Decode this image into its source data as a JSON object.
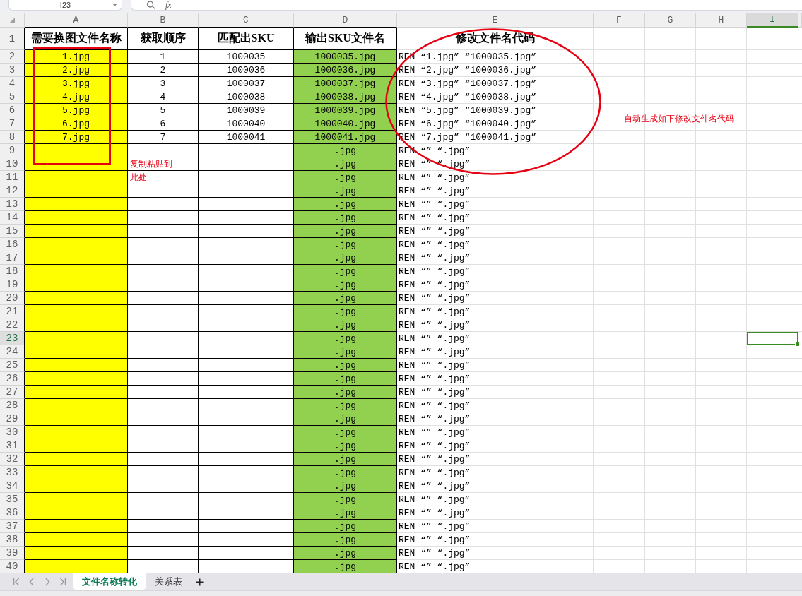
{
  "name_box": {
    "value": "I23"
  },
  "formula_bar": {
    "function_label": "fx"
  },
  "columns": [
    {
      "label": "A",
      "selected": false
    },
    {
      "label": "B",
      "selected": false
    },
    {
      "label": "C",
      "selected": false
    },
    {
      "label": "D",
      "selected": false
    },
    {
      "label": "E",
      "selected": false
    },
    {
      "label": "F",
      "selected": false
    },
    {
      "label": "G",
      "selected": false
    },
    {
      "label": "H",
      "selected": false
    },
    {
      "label": "I",
      "selected": true
    }
  ],
  "rows": [
    {
      "label": "1",
      "selected": false,
      "kind": "header",
      "a": "需要换图文件名称",
      "b": "获取顺序",
      "c": "匹配出SKU",
      "d": "输出SKU文件名",
      "e": "修改文件名代码"
    },
    {
      "label": "2",
      "selected": false,
      "kind": "data",
      "a": "1.jpg",
      "b": "1",
      "c": "1000035",
      "d": "1000035.jpg",
      "e": "REN “1.jpg” “1000035.jpg”"
    },
    {
      "label": "3",
      "selected": false,
      "kind": "data",
      "a": "2.jpg",
      "b": "2",
      "c": "1000036",
      "d": "1000036.jpg",
      "e": "REN “2.jpg” “1000036.jpg”"
    },
    {
      "label": "4",
      "selected": false,
      "kind": "data",
      "a": "3.jpg",
      "b": "3",
      "c": "1000037",
      "d": "1000037.jpg",
      "e": "REN “3.jpg” “1000037.jpg”"
    },
    {
      "label": "5",
      "selected": false,
      "kind": "data",
      "a": "4.jpg",
      "b": "4",
      "c": "1000038",
      "d": "1000038.jpg",
      "e": "REN “4.jpg” “1000038.jpg”"
    },
    {
      "label": "6",
      "selected": false,
      "kind": "data",
      "a": "5.jpg",
      "b": "5",
      "c": "1000039",
      "d": "1000039.jpg",
      "e": "REN “5.jpg” “1000039.jpg”"
    },
    {
      "label": "7",
      "selected": false,
      "kind": "data",
      "a": "6.jpg",
      "b": "6",
      "c": "1000040",
      "d": "1000040.jpg",
      "e": "REN “6.jpg” “1000040.jpg”"
    },
    {
      "label": "8",
      "selected": false,
      "kind": "data",
      "a": "7.jpg",
      "b": "7",
      "c": "1000041",
      "d": "1000041.jpg",
      "e": "REN “7.jpg” “1000041.jpg”"
    },
    {
      "label": "9",
      "selected": false,
      "kind": "data",
      "d": ".jpg",
      "e": "REN “” “.jpg”"
    },
    {
      "label": "10",
      "selected": false,
      "kind": "data",
      "d": ".jpg",
      "e": "REN “” “.jpg”"
    },
    {
      "label": "11",
      "selected": false,
      "kind": "data",
      "d": ".jpg",
      "e": "REN “” “.jpg”"
    },
    {
      "label": "12",
      "selected": false,
      "kind": "data",
      "d": ".jpg",
      "e": "REN “” “.jpg”"
    },
    {
      "label": "13",
      "selected": false,
      "kind": "data",
      "d": ".jpg",
      "e": "REN “” “.jpg”"
    },
    {
      "label": "14",
      "selected": false,
      "kind": "data",
      "d": ".jpg",
      "e": "REN “” “.jpg”"
    },
    {
      "label": "15",
      "selected": false,
      "kind": "data",
      "d": ".jpg",
      "e": "REN “” “.jpg”"
    },
    {
      "label": "16",
      "selected": false,
      "kind": "data",
      "d": ".jpg",
      "e": "REN “” “.jpg”"
    },
    {
      "label": "17",
      "selected": false,
      "kind": "data",
      "d": ".jpg",
      "e": "REN “” “.jpg”"
    },
    {
      "label": "18",
      "selected": false,
      "kind": "data",
      "d": ".jpg",
      "e": "REN “” “.jpg”"
    },
    {
      "label": "19",
      "selected": false,
      "kind": "data",
      "d": ".jpg",
      "e": "REN “” “.jpg”"
    },
    {
      "label": "20",
      "selected": false,
      "kind": "data",
      "d": ".jpg",
      "e": "REN “” “.jpg”"
    },
    {
      "label": "21",
      "selected": false,
      "kind": "data",
      "d": ".jpg",
      "e": "REN “” “.jpg”"
    },
    {
      "label": "22",
      "selected": false,
      "kind": "data",
      "d": ".jpg",
      "e": "REN “” “.jpg”"
    },
    {
      "label": "23",
      "selected": true,
      "kind": "data",
      "d": ".jpg",
      "e": "REN “” “.jpg”"
    },
    {
      "label": "24",
      "selected": false,
      "kind": "data",
      "d": ".jpg",
      "e": "REN “” “.jpg”"
    },
    {
      "label": "25",
      "selected": false,
      "kind": "data",
      "d": ".jpg",
      "e": "REN “” “.jpg”"
    },
    {
      "label": "26",
      "selected": false,
      "kind": "data",
      "d": ".jpg",
      "e": "REN “” “.jpg”"
    },
    {
      "label": "27",
      "selected": false,
      "kind": "data",
      "d": ".jpg",
      "e": "REN “” “.jpg”"
    },
    {
      "label": "28",
      "selected": false,
      "kind": "data",
      "d": ".jpg",
      "e": "REN “” “.jpg”"
    },
    {
      "label": "29",
      "selected": false,
      "kind": "data",
      "d": ".jpg",
      "e": "REN “” “.jpg”"
    },
    {
      "label": "30",
      "selected": false,
      "kind": "data",
      "d": ".jpg",
      "e": "REN “” “.jpg”"
    },
    {
      "label": "31",
      "selected": false,
      "kind": "data",
      "d": ".jpg",
      "e": "REN “” “.jpg”"
    },
    {
      "label": "32",
      "selected": false,
      "kind": "data",
      "d": ".jpg",
      "e": "REN “” “.jpg”"
    },
    {
      "label": "33",
      "selected": false,
      "kind": "data",
      "d": ".jpg",
      "e": "REN “” “.jpg”"
    },
    {
      "label": "34",
      "selected": false,
      "kind": "data",
      "d": ".jpg",
      "e": "REN “” “.jpg”"
    },
    {
      "label": "35",
      "selected": false,
      "kind": "data",
      "d": ".jpg",
      "e": "REN “” “.jpg”"
    },
    {
      "label": "36",
      "selected": false,
      "kind": "data",
      "d": ".jpg",
      "e": "REN “” “.jpg”"
    },
    {
      "label": "37",
      "selected": false,
      "kind": "data",
      "d": ".jpg",
      "e": "REN “” “.jpg”"
    },
    {
      "label": "38",
      "selected": false,
      "kind": "data",
      "d": ".jpg",
      "e": "REN “” “.jpg”"
    },
    {
      "label": "39",
      "selected": false,
      "kind": "data",
      "d": ".jpg",
      "e": "REN “” “.jpg”"
    },
    {
      "label": "40",
      "selected": false,
      "kind": "data",
      "d": ".jpg",
      "e": "REN “” “.jpg”"
    }
  ],
  "annotations": [
    {
      "kind": "rectangle"
    },
    {
      "kind": "ellipse"
    },
    {
      "kind": "note",
      "text": "复制粘贴到此处"
    },
    {
      "kind": "note",
      "text": "自动生成如下修改文件名代码"
    }
  ],
  "sheet_tabs": [
    {
      "label": "文件名称转化",
      "selected": true
    },
    {
      "label": "关系表",
      "selected": false
    }
  ]
}
